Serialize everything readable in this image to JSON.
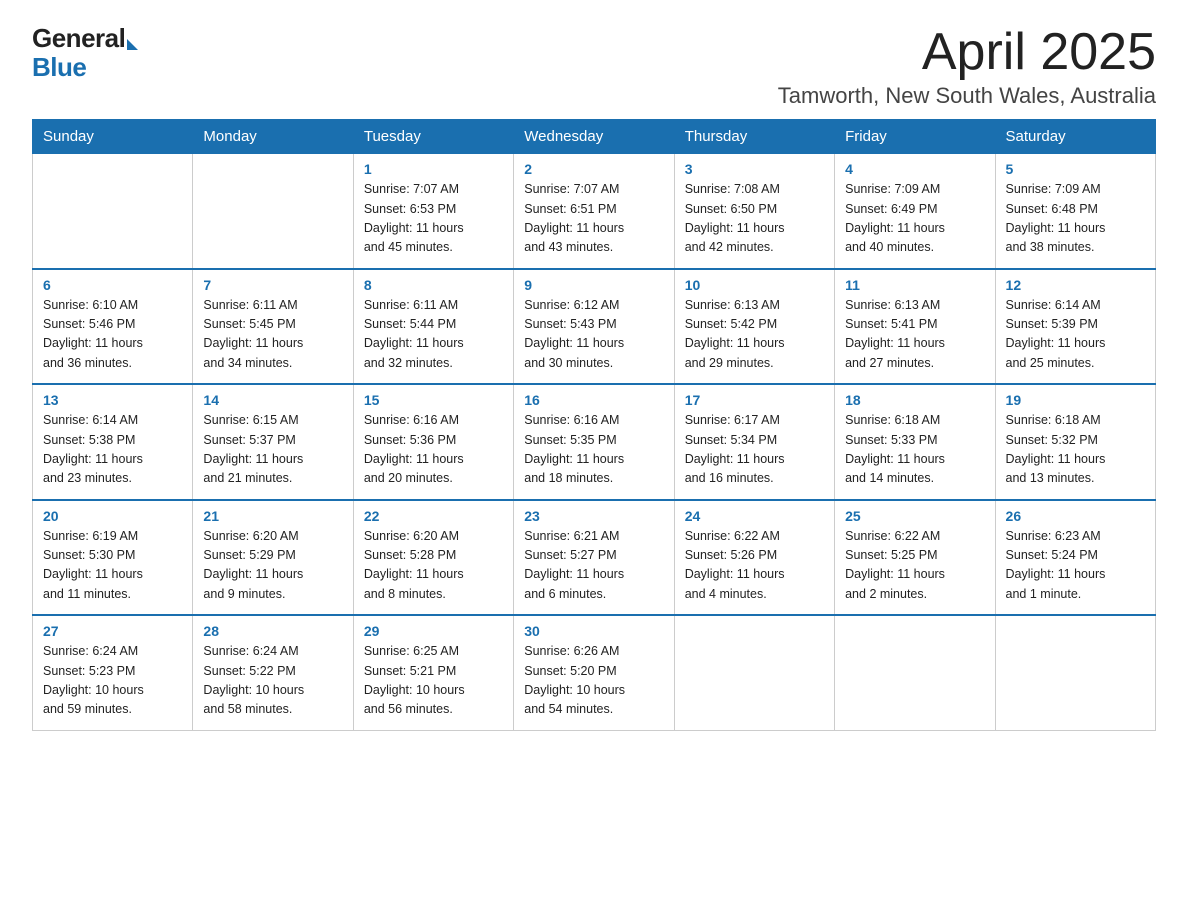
{
  "header": {
    "logo_general": "General",
    "logo_blue": "Blue",
    "title": "April 2025",
    "subtitle": "Tamworth, New South Wales, Australia"
  },
  "weekdays": [
    "Sunday",
    "Monday",
    "Tuesday",
    "Wednesday",
    "Thursday",
    "Friday",
    "Saturday"
  ],
  "weeks": [
    [
      {
        "day": "",
        "info": ""
      },
      {
        "day": "",
        "info": ""
      },
      {
        "day": "1",
        "info": "Sunrise: 7:07 AM\nSunset: 6:53 PM\nDaylight: 11 hours\nand 45 minutes."
      },
      {
        "day": "2",
        "info": "Sunrise: 7:07 AM\nSunset: 6:51 PM\nDaylight: 11 hours\nand 43 minutes."
      },
      {
        "day": "3",
        "info": "Sunrise: 7:08 AM\nSunset: 6:50 PM\nDaylight: 11 hours\nand 42 minutes."
      },
      {
        "day": "4",
        "info": "Sunrise: 7:09 AM\nSunset: 6:49 PM\nDaylight: 11 hours\nand 40 minutes."
      },
      {
        "day": "5",
        "info": "Sunrise: 7:09 AM\nSunset: 6:48 PM\nDaylight: 11 hours\nand 38 minutes."
      }
    ],
    [
      {
        "day": "6",
        "info": "Sunrise: 6:10 AM\nSunset: 5:46 PM\nDaylight: 11 hours\nand 36 minutes."
      },
      {
        "day": "7",
        "info": "Sunrise: 6:11 AM\nSunset: 5:45 PM\nDaylight: 11 hours\nand 34 minutes."
      },
      {
        "day": "8",
        "info": "Sunrise: 6:11 AM\nSunset: 5:44 PM\nDaylight: 11 hours\nand 32 minutes."
      },
      {
        "day": "9",
        "info": "Sunrise: 6:12 AM\nSunset: 5:43 PM\nDaylight: 11 hours\nand 30 minutes."
      },
      {
        "day": "10",
        "info": "Sunrise: 6:13 AM\nSunset: 5:42 PM\nDaylight: 11 hours\nand 29 minutes."
      },
      {
        "day": "11",
        "info": "Sunrise: 6:13 AM\nSunset: 5:41 PM\nDaylight: 11 hours\nand 27 minutes."
      },
      {
        "day": "12",
        "info": "Sunrise: 6:14 AM\nSunset: 5:39 PM\nDaylight: 11 hours\nand 25 minutes."
      }
    ],
    [
      {
        "day": "13",
        "info": "Sunrise: 6:14 AM\nSunset: 5:38 PM\nDaylight: 11 hours\nand 23 minutes."
      },
      {
        "day": "14",
        "info": "Sunrise: 6:15 AM\nSunset: 5:37 PM\nDaylight: 11 hours\nand 21 minutes."
      },
      {
        "day": "15",
        "info": "Sunrise: 6:16 AM\nSunset: 5:36 PM\nDaylight: 11 hours\nand 20 minutes."
      },
      {
        "day": "16",
        "info": "Sunrise: 6:16 AM\nSunset: 5:35 PM\nDaylight: 11 hours\nand 18 minutes."
      },
      {
        "day": "17",
        "info": "Sunrise: 6:17 AM\nSunset: 5:34 PM\nDaylight: 11 hours\nand 16 minutes."
      },
      {
        "day": "18",
        "info": "Sunrise: 6:18 AM\nSunset: 5:33 PM\nDaylight: 11 hours\nand 14 minutes."
      },
      {
        "day": "19",
        "info": "Sunrise: 6:18 AM\nSunset: 5:32 PM\nDaylight: 11 hours\nand 13 minutes."
      }
    ],
    [
      {
        "day": "20",
        "info": "Sunrise: 6:19 AM\nSunset: 5:30 PM\nDaylight: 11 hours\nand 11 minutes."
      },
      {
        "day": "21",
        "info": "Sunrise: 6:20 AM\nSunset: 5:29 PM\nDaylight: 11 hours\nand 9 minutes."
      },
      {
        "day": "22",
        "info": "Sunrise: 6:20 AM\nSunset: 5:28 PM\nDaylight: 11 hours\nand 8 minutes."
      },
      {
        "day": "23",
        "info": "Sunrise: 6:21 AM\nSunset: 5:27 PM\nDaylight: 11 hours\nand 6 minutes."
      },
      {
        "day": "24",
        "info": "Sunrise: 6:22 AM\nSunset: 5:26 PM\nDaylight: 11 hours\nand 4 minutes."
      },
      {
        "day": "25",
        "info": "Sunrise: 6:22 AM\nSunset: 5:25 PM\nDaylight: 11 hours\nand 2 minutes."
      },
      {
        "day": "26",
        "info": "Sunrise: 6:23 AM\nSunset: 5:24 PM\nDaylight: 11 hours\nand 1 minute."
      }
    ],
    [
      {
        "day": "27",
        "info": "Sunrise: 6:24 AM\nSunset: 5:23 PM\nDaylight: 10 hours\nand 59 minutes."
      },
      {
        "day": "28",
        "info": "Sunrise: 6:24 AM\nSunset: 5:22 PM\nDaylight: 10 hours\nand 58 minutes."
      },
      {
        "day": "29",
        "info": "Sunrise: 6:25 AM\nSunset: 5:21 PM\nDaylight: 10 hours\nand 56 minutes."
      },
      {
        "day": "30",
        "info": "Sunrise: 6:26 AM\nSunset: 5:20 PM\nDaylight: 10 hours\nand 54 minutes."
      },
      {
        "day": "",
        "info": ""
      },
      {
        "day": "",
        "info": ""
      },
      {
        "day": "",
        "info": ""
      }
    ]
  ]
}
